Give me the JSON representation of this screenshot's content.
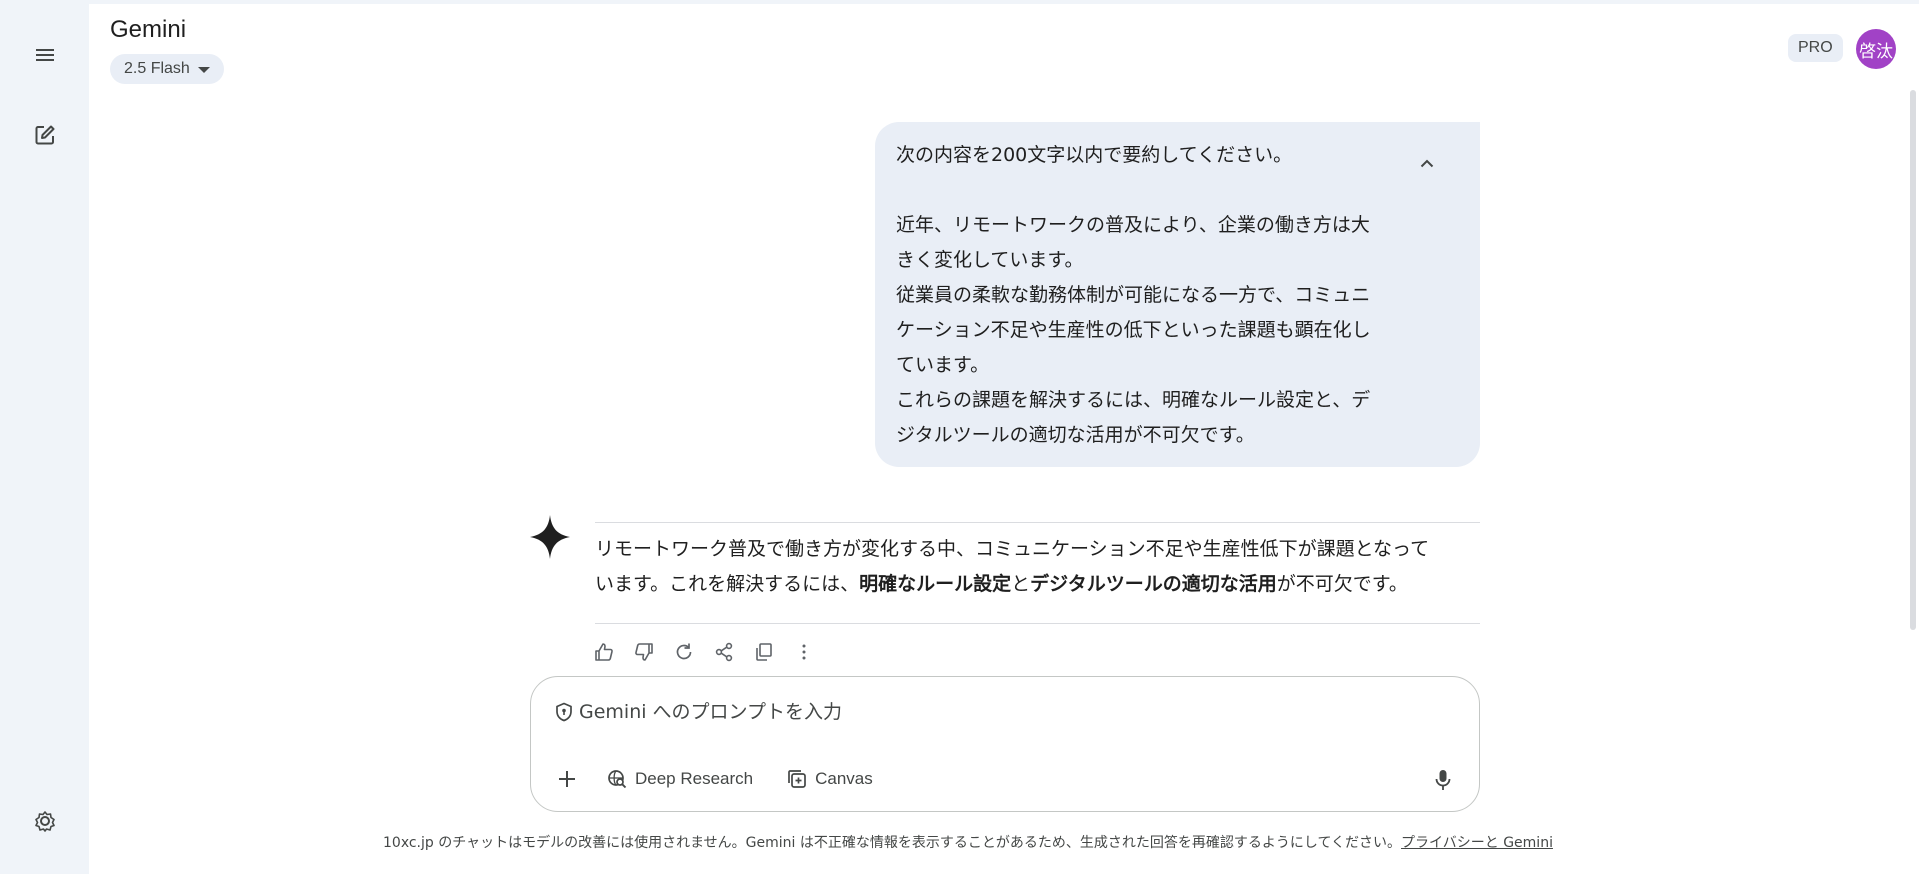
{
  "app": {
    "title": "Gemini",
    "model_label": "2.5 Flash",
    "pro_badge": "PRO",
    "avatar_text": "啓汰",
    "accent_color": "#a142c6"
  },
  "rail": {
    "icons": [
      "menu-icon",
      "new-chat-icon",
      "settings-icon"
    ]
  },
  "conversation": {
    "user_message": {
      "lines": [
        "次の内容を200文字以内で要約してください。",
        "",
        "近年、リモートワークの普及により、企業の働き方は大",
        "きく変化しています。",
        "従業員の柔軟な勤務体制が可能になる一方で、コミュニ",
        "ケーション不足や生産性の低下といった課題も顕在化し",
        "ています。",
        "これらの課題を解決するには、明確なルール設定と、デ",
        "ジタルツールの適切な活用が不可欠です。"
      ]
    },
    "response": {
      "line1": "リモートワーク普及で働き方が変化する中、コミュニケーション不足や生産性低下が課題となって",
      "line2_a": "います。これを解決するには、",
      "line2_b": "明確なルール設定",
      "line2_c": "と",
      "line2_d": "デジタルツールの適切な活用",
      "line2_e": "が不可欠です。"
    },
    "actions": [
      "thumbs-up-icon",
      "thumbs-down-icon",
      "regenerate-icon",
      "share-icon",
      "copy-icon",
      "more-icon"
    ]
  },
  "composer": {
    "placeholder": "Gemini へのプロンプトを入力",
    "value": "",
    "tools": {
      "deep_research": "Deep Research",
      "canvas": "Canvas"
    }
  },
  "footer": {
    "text": "10xc.jp のチャットはモデルの改善には使用されません。Gemini は不正確な情報を表示することがあるため、生成された回答を再確認するようにしてください。",
    "link": "プライバシーと Gemini"
  }
}
